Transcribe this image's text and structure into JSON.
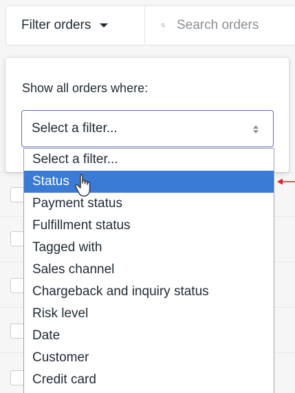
{
  "toolbar": {
    "filter_label": "Filter orders",
    "search_placeholder": "Search orders"
  },
  "popover": {
    "label": "Show all orders where:",
    "select_value": "Select a filter..."
  },
  "dropdown": {
    "selected_index": 1,
    "options": [
      "Select a filter...",
      "Status",
      "Payment status",
      "Fulfillment status",
      "Tagged with",
      "Sales channel",
      "Chargeback and inquiry status",
      "Risk level",
      "Date",
      "Customer",
      "Credit card"
    ]
  },
  "colors": {
    "highlight": "#3a7bd5",
    "focus_border": "#5c6ac4",
    "annotation_arrow": "#e02020"
  },
  "icons": [
    "search-icon",
    "caret-down-icon",
    "updown-icon",
    "pointer-cursor-icon",
    "annotation-arrow-icon"
  ]
}
